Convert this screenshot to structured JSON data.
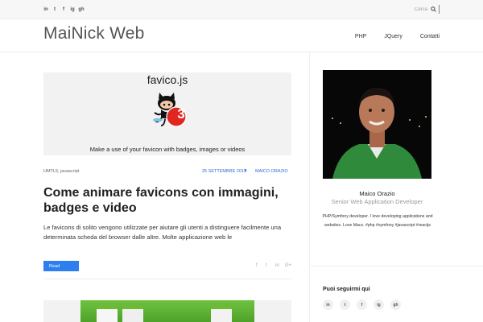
{
  "topbar": {
    "social": [
      "in",
      "t",
      "f",
      "ig",
      "gh"
    ],
    "search_placeholder": "Cerca"
  },
  "header": {
    "site_title": "MaiNick Web",
    "nav": [
      "PHP",
      "JQuery",
      "Contatti"
    ]
  },
  "post": {
    "image_title": "favico.js",
    "badge_number": "3",
    "image_caption": "Make a use of your favicon with badges, images or videos",
    "categories": "HMTL5, javascript",
    "date": "25 SETTEMBRE 2013",
    "author": "MAICO ORAZIO",
    "title": "Come animare favicons con immagini, badges e video",
    "excerpt": "Le favicons di solito vengono utilizzate per aiutare gli utenti a distinguere facilmente una determinata scheda del browser dalle altre. Molte applicazione web le",
    "read_label": "Read",
    "share": [
      "f",
      "t",
      "in",
      "G+"
    ]
  },
  "sidebar": {
    "author_name": "Maico Orazio",
    "author_role": "Senior Web Application Developer",
    "bio": "PHP/Symfony developer. I love developing applications and websites. Love Macs. #php #symfony #javascript #reactjs",
    "follow_title": "Puoi seguirmi qui",
    "follow_icons": [
      "in",
      "t",
      "f",
      "ig",
      "gh"
    ]
  },
  "colors": {
    "accent": "#2d7ff0",
    "link": "#2d6bd6",
    "badge": "#e0261e",
    "green": "#4ea22a"
  }
}
